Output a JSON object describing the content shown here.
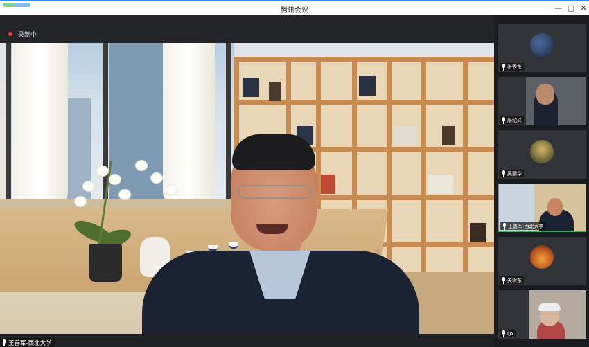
{
  "window": {
    "title": "腾讯会议",
    "minimize_glyph": "—",
    "maximize_glyph": "□",
    "close_glyph": "✕"
  },
  "recording": {
    "label": "录制中",
    "color": "#e8413c"
  },
  "main_speaker": {
    "name": "王善军-西北大学"
  },
  "participants": [
    {
      "name": "张秀东",
      "avatar": "dark-circle"
    },
    {
      "name": "唐绍义",
      "avatar": "camera-person"
    },
    {
      "name": "吴丽华",
      "avatar": "landscape-circle"
    },
    {
      "name": "王善军-西北大学",
      "avatar": "camera-person-bookshelf"
    },
    {
      "name": "关树东",
      "avatar": "sunset-cyclist-circle"
    },
    {
      "name": "Qx",
      "avatar": "camera-elderly-person"
    }
  ],
  "colors": {
    "accent": "#2e8df0",
    "sidebar_bg": "#1a1c20",
    "tile_bg": "#323338"
  }
}
